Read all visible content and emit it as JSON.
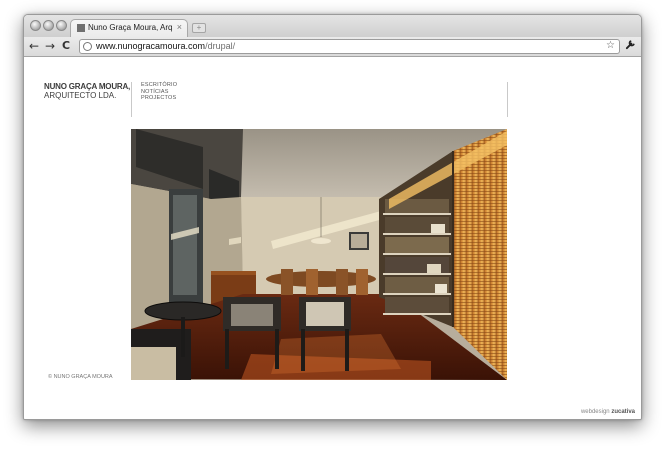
{
  "browser": {
    "tab_title": "Nuno Graça Moura, Arquitectos",
    "tab_close": "×",
    "new_tab": "+",
    "url_host": "www.nunogracamoura.com",
    "url_path": "/drupal/",
    "back": "←",
    "forward": "→",
    "reload": "C",
    "star": "☆",
    "wrench": "🔧"
  },
  "site": {
    "brand_line1": "NUNO GRAÇA MOURA,",
    "brand_line2": "ARQUITECTO LDA.",
    "menu": [
      "ESCRITÓRIO",
      "NOTÍCIAS",
      "PROJECTOS"
    ],
    "copyright": "© NUNO GRAÇA MOURA",
    "credit_label": "webdesign",
    "credit_name": "zucativa"
  }
}
